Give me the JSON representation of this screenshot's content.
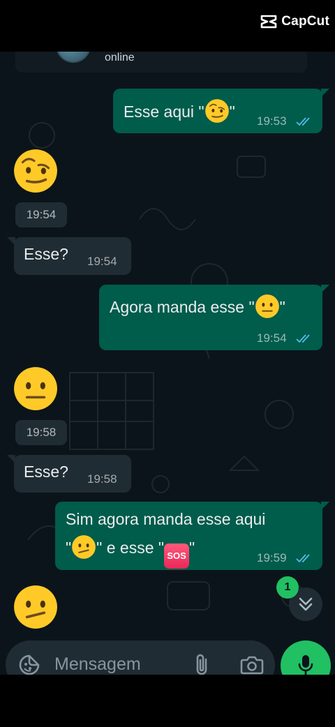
{
  "watermark": {
    "brand": "CapCut"
  },
  "header": {
    "status": "online"
  },
  "messages": [
    {
      "id": "m1",
      "type": "outgoing-text",
      "text": "Esse aqui \"",
      "emoji": "raised-eyebrow-face",
      "text_after": "\"",
      "time": "19:53",
      "status": "read"
    },
    {
      "id": "m2",
      "type": "incoming-emoji",
      "emoji": "raised-eyebrow-face",
      "time": "19:54"
    },
    {
      "id": "m3",
      "type": "incoming-text",
      "text": "Esse?",
      "time": "19:54"
    },
    {
      "id": "m4",
      "type": "outgoing-text",
      "text": "Agora manda esse \"",
      "emoji": "neutral-face",
      "text_after": "\"",
      "time": "19:54",
      "status": "read"
    },
    {
      "id": "m5",
      "type": "incoming-emoji",
      "emoji": "neutral-face",
      "time": "19:58"
    },
    {
      "id": "m6",
      "type": "incoming-text",
      "text": "Esse?",
      "time": "19:58"
    },
    {
      "id": "m7",
      "type": "outgoing-text",
      "line1": "Sim agora manda esse aqui",
      "line2_a": "\"",
      "emoji": "confused-face",
      "line2_b": "\" e esse \"",
      "emoji2_label": "SOS",
      "line2_c": "\"",
      "time": "19:59",
      "status": "read"
    },
    {
      "id": "m8",
      "type": "incoming-emoji",
      "emoji": "confused-face"
    }
  ],
  "scroll_to_bottom": {
    "unread_count": "1"
  },
  "composer": {
    "placeholder": "Mensagem"
  },
  "colors": {
    "outgoing_bubble": "#005c4b",
    "incoming_bubble": "#202c33",
    "background": "#0b141a",
    "accent": "#21c063",
    "read_ticks": "#53bdeb"
  }
}
